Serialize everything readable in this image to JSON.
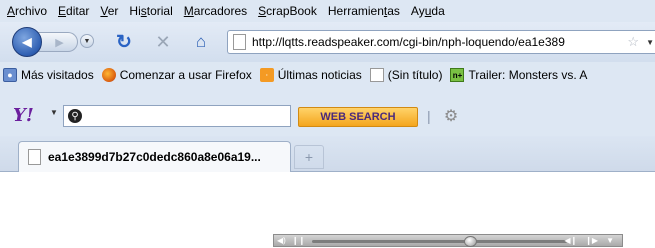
{
  "menu": [
    {
      "pre": "",
      "key": "A",
      "post": "rchivo"
    },
    {
      "pre": "",
      "key": "E",
      "post": "ditar"
    },
    {
      "pre": "",
      "key": "V",
      "post": "er"
    },
    {
      "pre": "Hi",
      "key": "s",
      "post": "torial"
    },
    {
      "pre": "",
      "key": "M",
      "post": "arcadores"
    },
    {
      "pre": "",
      "key": "S",
      "post": "crapBook"
    },
    {
      "pre": "Herramien",
      "key": "t",
      "post": "as"
    },
    {
      "pre": "Ay",
      "key": "u",
      "post": "da"
    }
  ],
  "nav": {
    "url": "http://lqtts.readspeaker.com/cgi-bin/nph-loquendo/ea1e389"
  },
  "bookmarks": [
    {
      "label": "Más visitados",
      "icon": "most-visited-icon"
    },
    {
      "label": "Comenzar a usar Firefox",
      "icon": "firefox-icon"
    },
    {
      "label": "Últimas noticias",
      "icon": "rss-feed-icon"
    },
    {
      "label": "(Sin título)",
      "icon": "blank-page-icon"
    },
    {
      "label": "Trailer: Monsters vs. A",
      "icon": "nplus-icon"
    }
  ],
  "yahoo": {
    "logo": "Y!",
    "search_value": "",
    "search_button": "WEB SEARCH"
  },
  "tabs": [
    {
      "label": "ea1e3899d7b27c0dedc860a8e06a19...",
      "icon": "blank-page-icon"
    }
  ],
  "newtab_symbol": "+",
  "player": {
    "progress": 0.62
  },
  "colors": {
    "chrome": "#dde7f3",
    "yahoo_purple": "#6b1f9d",
    "search_button": "#f4a51d"
  }
}
